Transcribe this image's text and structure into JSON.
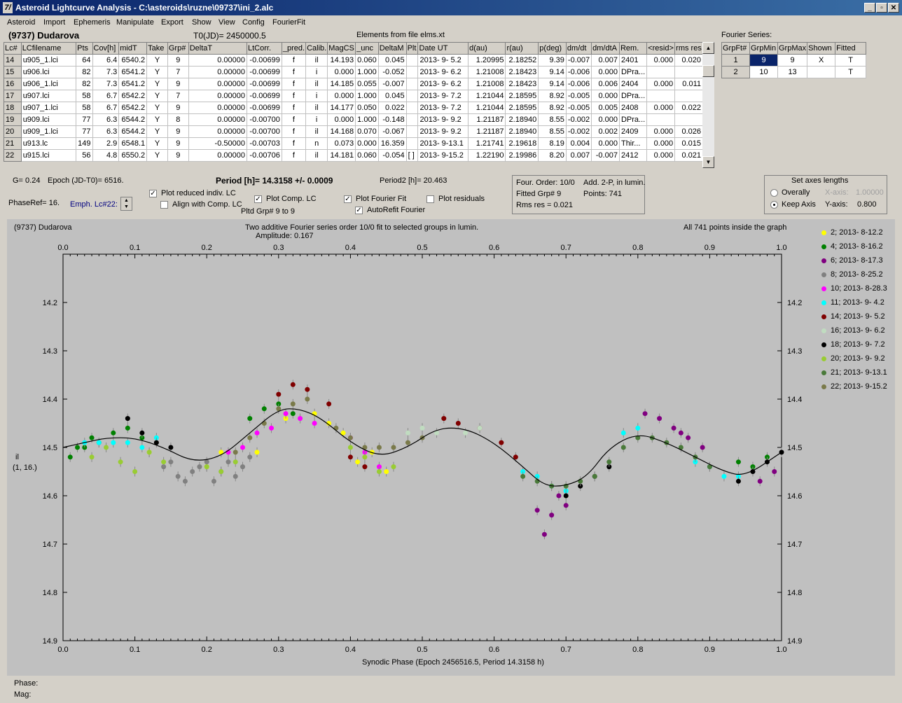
{
  "window": {
    "title": "Asteroid Lightcurve Analysis - C:\\asteroids\\ruzne\\09737\\ini_2.alc",
    "icon": "7/"
  },
  "menu": [
    "Asteroid",
    "Import",
    "Ephemeris",
    "Manipulate",
    "Export",
    "Show",
    "View",
    "Config",
    "FourierFit"
  ],
  "header": {
    "object": "(9737) Dudarova",
    "t0": "T0(JD)= 2450000.5",
    "elements": "Elements from file elms.xt",
    "fourier_series": "Fourier Series:"
  },
  "lc_table": {
    "columns": [
      "Lc#",
      "LCfilename",
      "Pts",
      "Cov[h]",
      "midT",
      "Take",
      "Grp#",
      "DeltaT",
      "LtCorr.",
      "_pred.",
      "Calib.",
      "MagCS",
      "_unc",
      "DeltaM",
      "Plt",
      "Date UT",
      "d(au)",
      "r(au)",
      "p(deg)",
      "dm/dt",
      "dm/dtA",
      "Rem.",
      "<resid>",
      "rms res"
    ],
    "rows": [
      [
        "14",
        "u905_1.lci",
        "64",
        "6.4",
        "6540.2",
        "Y",
        "9",
        "0.00000",
        "-0.00699",
        "f",
        "il",
        "14.193",
        "0.060",
        "0.045",
        "",
        "2013- 9- 5.2",
        "1.20995",
        "2.18252",
        "9.39",
        "-0.007",
        "0.007",
        "2401",
        "0.000",
        "0.020"
      ],
      [
        "15",
        "u906.lci",
        "82",
        "7.3",
        "6541.2",
        "Y",
        "7",
        "0.00000",
        "-0.00699",
        "f",
        "i",
        "0.000",
        "1.000",
        "-0.052",
        "",
        "2013- 9- 6.2",
        "1.21008",
        "2.18423",
        "9.14",
        "-0.006",
        "0.000",
        "DPra...",
        "",
        ""
      ],
      [
        "16",
        "u906_1.lci",
        "82",
        "7.3",
        "6541.2",
        "Y",
        "9",
        "0.00000",
        "-0.00699",
        "f",
        "il",
        "14.185",
        "0.055",
        "-0.007",
        "",
        "2013- 9- 6.2",
        "1.21008",
        "2.18423",
        "9.14",
        "-0.006",
        "0.006",
        "2404",
        "0.000",
        "0.011"
      ],
      [
        "17",
        "u907.lci",
        "58",
        "6.7",
        "6542.2",
        "Y",
        "7",
        "0.00000",
        "-0.00699",
        "f",
        "i",
        "0.000",
        "1.000",
        "0.045",
        "",
        "2013- 9- 7.2",
        "1.21044",
        "2.18595",
        "8.92",
        "-0.005",
        "0.000",
        "DPra...",
        "",
        ""
      ],
      [
        "18",
        "u907_1.lci",
        "58",
        "6.7",
        "6542.2",
        "Y",
        "9",
        "0.00000",
        "-0.00699",
        "f",
        "il",
        "14.177",
        "0.050",
        "0.022",
        "",
        "2013- 9- 7.2",
        "1.21044",
        "2.18595",
        "8.92",
        "-0.005",
        "0.005",
        "2408",
        "0.000",
        "0.022"
      ],
      [
        "19",
        "u909.lci",
        "77",
        "6.3",
        "6544.2",
        "Y",
        "8",
        "0.00000",
        "-0.00700",
        "f",
        "i",
        "0.000",
        "1.000",
        "-0.148",
        "",
        "2013- 9- 9.2",
        "1.21187",
        "2.18940",
        "8.55",
        "-0.002",
        "0.000",
        "DPra...",
        "",
        ""
      ],
      [
        "20",
        "u909_1.lci",
        "77",
        "6.3",
        "6544.2",
        "Y",
        "9",
        "0.00000",
        "-0.00700",
        "f",
        "il",
        "14.168",
        "0.070",
        "-0.067",
        "",
        "2013- 9- 9.2",
        "1.21187",
        "2.18940",
        "8.55",
        "-0.002",
        "0.002",
        "2409",
        "0.000",
        "0.026"
      ],
      [
        "21",
        "u913.lc",
        "149",
        "2.9",
        "6548.1",
        "Y",
        "9",
        "-0.50000",
        "-0.00703",
        "f",
        "n",
        "0.073",
        "0.000",
        "16.359",
        "",
        "2013- 9-13.1",
        "1.21741",
        "2.19618",
        "8.19",
        "0.004",
        "0.000",
        "Thir...",
        "0.000",
        "0.015"
      ],
      [
        "22",
        "u915.lci",
        "56",
        "4.8",
        "6550.2",
        "Y",
        "9",
        "0.00000",
        "-0.00706",
        "f",
        "il",
        "14.181",
        "0.060",
        "-0.054",
        "[ ]",
        "2013- 9-15.2",
        "1.22190",
        "2.19986",
        "8.20",
        "0.007",
        "-0.007",
        "2412",
        "0.000",
        "0.021"
      ]
    ]
  },
  "fourier_table": {
    "columns": [
      "GrpFt#",
      "GrpMin",
      "GrpMax",
      "Shown",
      "Fitted"
    ],
    "rows": [
      [
        "1",
        "9",
        "9",
        "X",
        "T"
      ],
      [
        "2",
        "10",
        "13",
        "",
        "T"
      ]
    ]
  },
  "controls": {
    "g": "G= 0.24",
    "epoch": "Epoch (JD-T0)= 6516.",
    "period": "Period [h]= 14.3158 +/- 0.0009",
    "period2": "Period2 [h]= 20.463",
    "phaseref": "PhaseRef= 16.",
    "emph": "Emph. Lc#22:",
    "plot_reduced": "Plot reduced indiv. LC",
    "align": "Align with Comp. LC",
    "plot_comp": "Plot Comp. LC",
    "pltd_grp": "Pltd Grp#  9   to   9",
    "plot_fourier": "Plot Fourier Fit",
    "autorefit": "AutoRefit Fourier",
    "plot_resid": "Plot residuals",
    "four_order": "Four. Order: 10/0",
    "add2p": "Add. 2-P, in lumin.",
    "fitted_grp": "Fitted Grp# 9",
    "points": "Points: 741",
    "rms": "Rms res      = 0.021",
    "set_axes": "Set axes lengths",
    "overally": "Overally",
    "keep_axis": "Keep Axis",
    "x_axis_lbl": "X-axis:",
    "x_axis_val": "1.00000",
    "y_axis_lbl": "Y-axis:",
    "y_axis_val": "0.800"
  },
  "plot": {
    "name": "(9737) Dudarova",
    "subtitle": "Two additive Fourier series order 10/0 fit to selected groups in lumin.",
    "amplitude": "Amplitude: 0.167",
    "points_info": "All 741 points inside the graph",
    "ylabel": "il",
    "ylabel2": "(1, 16.)",
    "xlabel": "Synodic Phase (Epoch 2456516.5, Period 14.3158 h)"
  },
  "status": {
    "phase": "Phase:",
    "mag": "Mag:"
  },
  "chart_data": {
    "type": "scatter",
    "xlabel": "Synodic Phase (Epoch 2456516.5, Period 14.3158 h)",
    "ylabel": "il",
    "xlim": [
      0.0,
      1.0
    ],
    "ylim": [
      14.1,
      14.9
    ],
    "y_inverted": true,
    "x_ticks": [
      "0.0",
      "0.1",
      "0.2",
      "0.3",
      "0.4",
      "0.5",
      "0.6",
      "0.7",
      "0.8",
      "0.9",
      "1.0"
    ],
    "y_ticks": [
      "14.2",
      "14.3",
      "14.4",
      "14.5",
      "14.6",
      "14.7",
      "14.8",
      "14.9"
    ],
    "legend_position": "right",
    "grid": false,
    "fourier_fit": {
      "x": [
        0.0,
        0.03,
        0.06,
        0.1,
        0.14,
        0.18,
        0.22,
        0.26,
        0.3,
        0.33,
        0.36,
        0.4,
        0.44,
        0.48,
        0.52,
        0.56,
        0.6,
        0.64,
        0.67,
        0.7,
        0.73,
        0.76,
        0.8,
        0.84,
        0.88,
        0.92,
        0.95,
        1.0
      ],
      "y": [
        14.5,
        14.49,
        14.48,
        14.48,
        14.5,
        14.53,
        14.52,
        14.47,
        14.42,
        14.42,
        14.44,
        14.49,
        14.52,
        14.5,
        14.46,
        14.46,
        14.49,
        14.54,
        14.58,
        14.58,
        14.56,
        14.5,
        14.47,
        14.49,
        14.52,
        14.55,
        14.56,
        14.51
      ]
    },
    "series": [
      {
        "name": "2; 2013- 8-12.2",
        "color": "#ffff00",
        "x": [
          0.27,
          0.31,
          0.35,
          0.37,
          0.39,
          0.41,
          0.43,
          0.2,
          0.22,
          0.12,
          0.45
        ],
        "y": [
          14.51,
          14.44,
          14.43,
          14.45,
          14.47,
          14.53,
          14.51,
          14.54,
          14.51,
          14.51,
          14.55
        ]
      },
      {
        "name": "4; 2013- 8-16.2",
        "color": "#008000",
        "x": [
          0.01,
          0.03,
          0.05,
          0.07,
          0.09,
          0.11,
          0.02,
          0.04,
          0.26,
          0.28,
          0.3,
          0.32,
          0.96,
          0.98,
          0.94
        ],
        "y": [
          14.52,
          14.5,
          14.49,
          14.47,
          14.46,
          14.48,
          14.5,
          14.48,
          14.44,
          14.42,
          14.41,
          14.43,
          14.54,
          14.52,
          14.53
        ]
      },
      {
        "name": "6; 2013- 8-17.3",
        "color": "#800080",
        "x": [
          0.66,
          0.68,
          0.69,
          0.7,
          0.67,
          0.81,
          0.83,
          0.85,
          0.87,
          0.89,
          0.97,
          0.99,
          0.86
        ],
        "y": [
          14.63,
          14.64,
          14.6,
          14.62,
          14.68,
          14.43,
          14.44,
          14.46,
          14.48,
          14.5,
          14.57,
          14.55,
          14.47
        ]
      },
      {
        "name": "8; 2013- 8-25.2",
        "color": "#808080",
        "x": [
          0.14,
          0.16,
          0.18,
          0.2,
          0.22,
          0.24,
          0.26,
          0.15,
          0.17,
          0.19,
          0.21,
          0.23,
          0.25
        ],
        "y": [
          14.54,
          14.56,
          14.55,
          14.53,
          14.55,
          14.56,
          14.52,
          14.53,
          14.57,
          14.54,
          14.57,
          14.53,
          14.54
        ]
      },
      {
        "name": "10; 2013- 8-28.3",
        "color": "#ff00ff",
        "x": [
          0.23,
          0.25,
          0.27,
          0.29,
          0.31,
          0.33,
          0.35,
          0.4,
          0.42,
          0.44
        ],
        "y": [
          14.51,
          14.5,
          14.47,
          14.46,
          14.43,
          14.44,
          14.45,
          14.48,
          14.51,
          14.54
        ]
      },
      {
        "name": "11; 2013- 9- 4.2",
        "color": "#00ffff",
        "x": [
          0.07,
          0.09,
          0.11,
          0.13,
          0.03,
          0.05,
          0.64,
          0.66,
          0.68,
          0.7,
          0.78,
          0.8,
          0.88,
          0.9,
          0.92,
          0.94
        ],
        "y": [
          14.49,
          14.49,
          14.5,
          14.48,
          14.49,
          14.49,
          14.55,
          14.56,
          14.58,
          14.59,
          14.47,
          14.46,
          14.53,
          14.54,
          14.56,
          14.56
        ]
      },
      {
        "name": "14; 2013- 9- 5.2",
        "color": "#800000",
        "x": [
          0.4,
          0.42,
          0.53,
          0.55,
          0.58,
          0.61,
          0.63,
          0.3,
          0.32,
          0.34,
          0.37
        ],
        "y": [
          14.52,
          14.54,
          14.44,
          14.45,
          14.46,
          14.49,
          14.52,
          14.39,
          14.37,
          14.38,
          14.41
        ]
      },
      {
        "name": "16; 2013- 9- 6.2",
        "color": "#c0dcc0",
        "x": [
          0.48,
          0.5,
          0.52,
          0.56,
          0.58
        ],
        "y": [
          14.47,
          14.46,
          14.47,
          14.47,
          14.46
        ]
      },
      {
        "name": "18; 2013- 9- 7.2",
        "color": "#000000",
        "x": [
          0.09,
          0.11,
          0.13,
          0.15,
          0.7,
          0.72,
          0.74,
          0.76,
          0.94,
          0.96,
          0.98,
          1.0
        ],
        "y": [
          14.44,
          14.47,
          14.49,
          14.5,
          14.6,
          14.58,
          14.56,
          14.54,
          14.57,
          14.55,
          14.53,
          14.51
        ]
      },
      {
        "name": "20; 2013- 9- 9.2",
        "color": "#99cc33",
        "x": [
          0.04,
          0.06,
          0.08,
          0.1,
          0.12,
          0.14,
          0.2,
          0.22,
          0.24,
          0.4,
          0.42,
          0.44,
          0.46
        ],
        "y": [
          14.52,
          14.5,
          14.53,
          14.55,
          14.51,
          14.53,
          14.54,
          14.55,
          14.53,
          14.5,
          14.52,
          14.55,
          14.54
        ]
      },
      {
        "name": "21; 2013- 9-13.1",
        "color": "#4a7a3a",
        "x": [
          0.64,
          0.66,
          0.68,
          0.7,
          0.72,
          0.74,
          0.76,
          0.78,
          0.8,
          0.82,
          0.84,
          0.86,
          0.88,
          0.9
        ],
        "y": [
          14.56,
          14.57,
          14.58,
          14.58,
          14.57,
          14.56,
          14.53,
          14.5,
          14.48,
          14.48,
          14.49,
          14.5,
          14.52,
          14.54
        ]
      },
      {
        "name": "22; 2013- 9-15.2",
        "color": "#7a7a4a",
        "x": [
          0.38,
          0.4,
          0.42,
          0.44,
          0.46,
          0.48,
          0.5,
          0.24,
          0.26,
          0.28,
          0.3,
          0.32,
          0.34
        ],
        "y": [
          14.46,
          14.48,
          14.5,
          14.5,
          14.5,
          14.49,
          14.48,
          14.51,
          14.48,
          14.45,
          14.42,
          14.41,
          14.4
        ]
      }
    ]
  }
}
